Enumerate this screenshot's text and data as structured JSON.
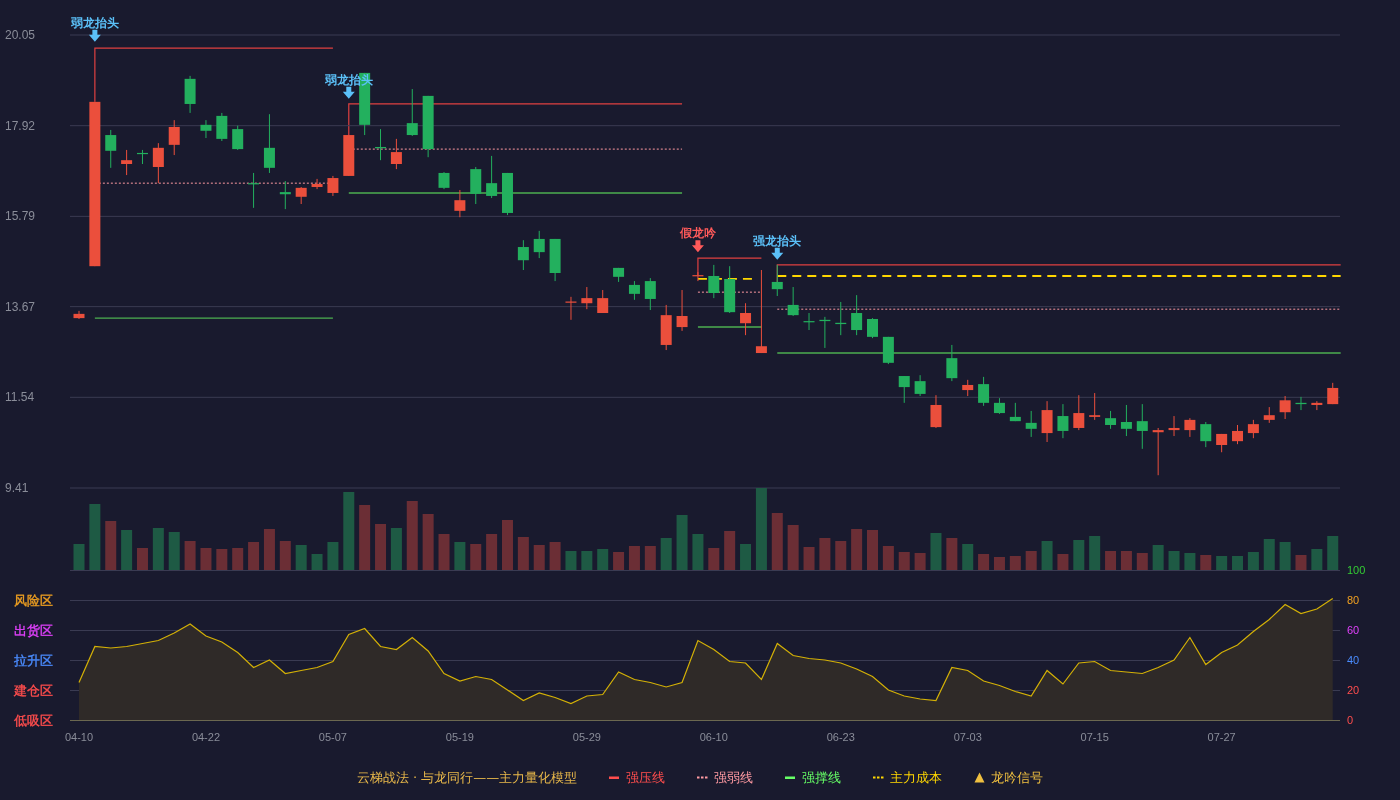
{
  "price_chart": {
    "chart_data": {
      "type": "candlestick",
      "grid": true,
      "ylim": [
        9.41,
        20.05
      ],
      "yticks": [
        20.05,
        17.92,
        15.79,
        13.67,
        11.54,
        9.41
      ],
      "ohlc": [
        [
          13.4,
          13.57,
          13.38,
          13.5
        ],
        [
          14.62,
          18.48,
          14.62,
          18.48
        ],
        [
          17.7,
          17.82,
          16.93,
          17.33
        ],
        [
          17.02,
          17.35,
          16.76,
          17.11
        ],
        [
          17.28,
          17.35,
          17.02,
          17.26
        ],
        [
          16.95,
          17.51,
          16.57,
          17.4
        ],
        [
          17.47,
          18.05,
          17.23,
          17.89
        ],
        [
          19.02,
          19.09,
          18.22,
          18.43
        ],
        [
          17.94,
          18.05,
          17.63,
          17.8
        ],
        [
          18.15,
          18.22,
          17.56,
          17.61
        ],
        [
          17.84,
          17.92,
          17.35,
          17.37
        ],
        [
          16.57,
          16.81,
          15.99,
          16.55
        ],
        [
          17.4,
          18.19,
          16.81,
          16.93
        ],
        [
          16.36,
          16.62,
          15.96,
          16.31
        ],
        [
          16.25,
          16.48,
          16.08,
          16.46
        ],
        [
          16.48,
          16.67,
          16.43,
          16.55
        ],
        [
          16.34,
          16.74,
          16.27,
          16.69
        ],
        [
          16.74,
          17.7,
          16.74,
          17.7
        ],
        [
          19.16,
          19.16,
          17.7,
          17.94
        ],
        [
          17.42,
          17.84,
          17.11,
          17.39
        ],
        [
          17.02,
          17.61,
          16.9,
          17.3
        ],
        [
          17.98,
          18.78,
          17.68,
          17.7
        ],
        [
          18.62,
          18.62,
          17.18,
          17.37
        ],
        [
          16.81,
          16.83,
          16.43,
          16.46
        ],
        [
          15.92,
          16.41,
          15.77,
          16.17
        ],
        [
          16.9,
          16.95,
          16.08,
          16.32
        ],
        [
          16.57,
          17.21,
          16.22,
          16.27
        ],
        [
          16.81,
          16.81,
          15.82,
          15.87
        ],
        [
          15.07,
          15.23,
          14.53,
          14.76
        ],
        [
          15.26,
          15.45,
          14.81,
          14.95
        ],
        [
          15.26,
          15.26,
          14.27,
          14.46
        ],
        [
          13.77,
          13.9,
          13.36,
          13.79
        ],
        [
          13.75,
          14.13,
          13.61,
          13.87
        ],
        [
          13.52,
          14.06,
          13.52,
          13.87
        ],
        [
          14.58,
          14.58,
          14.25,
          14.37
        ],
        [
          14.18,
          14.27,
          13.83,
          13.97
        ],
        [
          14.27,
          14.34,
          13.59,
          13.85
        ],
        [
          12.77,
          13.71,
          12.65,
          13.47
        ],
        [
          13.19,
          14.06,
          13.1,
          13.45
        ],
        [
          14.39,
          14.48,
          14.27,
          14.41
        ],
        [
          14.39,
          14.65,
          13.87,
          13.99
        ],
        [
          14.32,
          14.62,
          13.52,
          13.54
        ],
        [
          13.28,
          13.75,
          13.0,
          13.52
        ],
        [
          12.58,
          14.53,
          12.58,
          12.74
        ],
        [
          14.25,
          14.65,
          13.92,
          14.08
        ],
        [
          13.71,
          14.13,
          13.45,
          13.47
        ],
        [
          13.33,
          13.52,
          13.12,
          13.31
        ],
        [
          13.36,
          13.43,
          12.7,
          13.33
        ],
        [
          13.29,
          13.78,
          13.0,
          13.26
        ],
        [
          13.52,
          13.94,
          13.0,
          13.12
        ],
        [
          13.38,
          13.4,
          12.93,
          12.96
        ],
        [
          12.96,
          12.96,
          12.32,
          12.35
        ],
        [
          12.04,
          12.04,
          11.41,
          11.78
        ],
        [
          11.92,
          12.06,
          11.57,
          11.62
        ],
        [
          10.84,
          11.59,
          10.82,
          11.36
        ],
        [
          12.46,
          12.77,
          11.92,
          11.99
        ],
        [
          11.71,
          11.95,
          11.57,
          11.83
        ],
        [
          11.85,
          12.02,
          11.34,
          11.41
        ],
        [
          11.41,
          11.52,
          11.15,
          11.17
        ],
        [
          11.08,
          11.41,
          10.98,
          10.98
        ],
        [
          10.94,
          11.22,
          10.61,
          10.8
        ],
        [
          10.7,
          11.45,
          10.49,
          11.24
        ],
        [
          11.1,
          11.38,
          10.58,
          10.75
        ],
        [
          10.82,
          11.59,
          10.77,
          11.17
        ],
        [
          11.08,
          11.64,
          11.01,
          11.12
        ],
        [
          11.05,
          11.22,
          10.8,
          10.89
        ],
        [
          10.96,
          11.36,
          10.63,
          10.8
        ],
        [
          10.98,
          11.38,
          10.33,
          10.75
        ],
        [
          10.72,
          10.82,
          9.71,
          10.77
        ],
        [
          10.77,
          11.1,
          10.63,
          10.82
        ],
        [
          10.77,
          11.05,
          10.61,
          11.01
        ],
        [
          10.91,
          10.96,
          10.37,
          10.51
        ],
        [
          10.42,
          10.68,
          10.25,
          10.68
        ],
        [
          10.51,
          10.89,
          10.44,
          10.75
        ],
        [
          10.7,
          11.01,
          10.58,
          10.91
        ],
        [
          11.01,
          11.31,
          10.94,
          11.12
        ],
        [
          11.19,
          11.57,
          11.03,
          11.47
        ],
        [
          11.41,
          11.55,
          11.24,
          11.38
        ],
        [
          11.36,
          11.45,
          11.24,
          11.41
        ],
        [
          11.38,
          11.88,
          11.38,
          11.76
        ]
      ]
    },
    "signals": [
      {
        "text": "弱龙抬头",
        "color": "#5bc0f8"
      },
      {
        "text": "弱龙抬头",
        "color": "#5bc0f8"
      },
      {
        "text": "假龙吟",
        "color": "#ff5a5a"
      },
      {
        "text": "强龙抬头",
        "color": "#5bc0f8"
      }
    ]
  },
  "indicator_chart": {
    "chart_data": {
      "type": "area",
      "ylim": [
        0,
        100
      ],
      "grid": true,
      "yticks": [
        0,
        20,
        40,
        60,
        80,
        100
      ],
      "series": [
        {
          "color": "#d4b106",
          "values": [
            25,
            49,
            48,
            49,
            51,
            53,
            58,
            64,
            56,
            52,
            45,
            35,
            40,
            31,
            33,
            35,
            39,
            57,
            61,
            49,
            47,
            55,
            46,
            31,
            26,
            29,
            27,
            20,
            13,
            18,
            15,
            11,
            16,
            17,
            32,
            27,
            25,
            22,
            25,
            53,
            47,
            39,
            38,
            27,
            51,
            43,
            41,
            40,
            38,
            34,
            29,
            20,
            16,
            14,
            13,
            35,
            33,
            26,
            23,
            19,
            16,
            33,
            24,
            38,
            39,
            33,
            32,
            31,
            35,
            40,
            55,
            37,
            45,
            50,
            59,
            67,
            77,
            71,
            74,
            81
          ]
        }
      ]
    },
    "zones": [
      {
        "label": "风险区",
        "color": "#f0a020"
      },
      {
        "label": "出货区",
        "color": "#e040fb"
      },
      {
        "label": "拉升区",
        "color": "#4a8cff"
      },
      {
        "label": "建仓区",
        "color": "#ff4d4d"
      },
      {
        "label": "低吸区",
        "color": "#ff4d4d"
      }
    ],
    "date_labels": [
      "04-10",
      "04-22",
      "05-07",
      "05-19",
      "05-29",
      "06-10",
      "06-23",
      "07-03",
      "07-15",
      "07-27"
    ]
  },
  "legend": {
    "title": "云梯战法 · 与龙同行——主力量化模型",
    "items": [
      {
        "label": "强压线",
        "kind": "solid",
        "color": "#ff4d4d"
      },
      {
        "label": "强弱线",
        "kind": "dashed",
        "color": "#ff9aa2"
      },
      {
        "label": "强撑线",
        "kind": "solid",
        "color": "#66ff66"
      },
      {
        "label": "主力成本",
        "kind": "dashed",
        "color": "#ffd700"
      },
      {
        "label": "龙吟信号",
        "kind": "triangle",
        "color": "#f0c040"
      }
    ]
  }
}
